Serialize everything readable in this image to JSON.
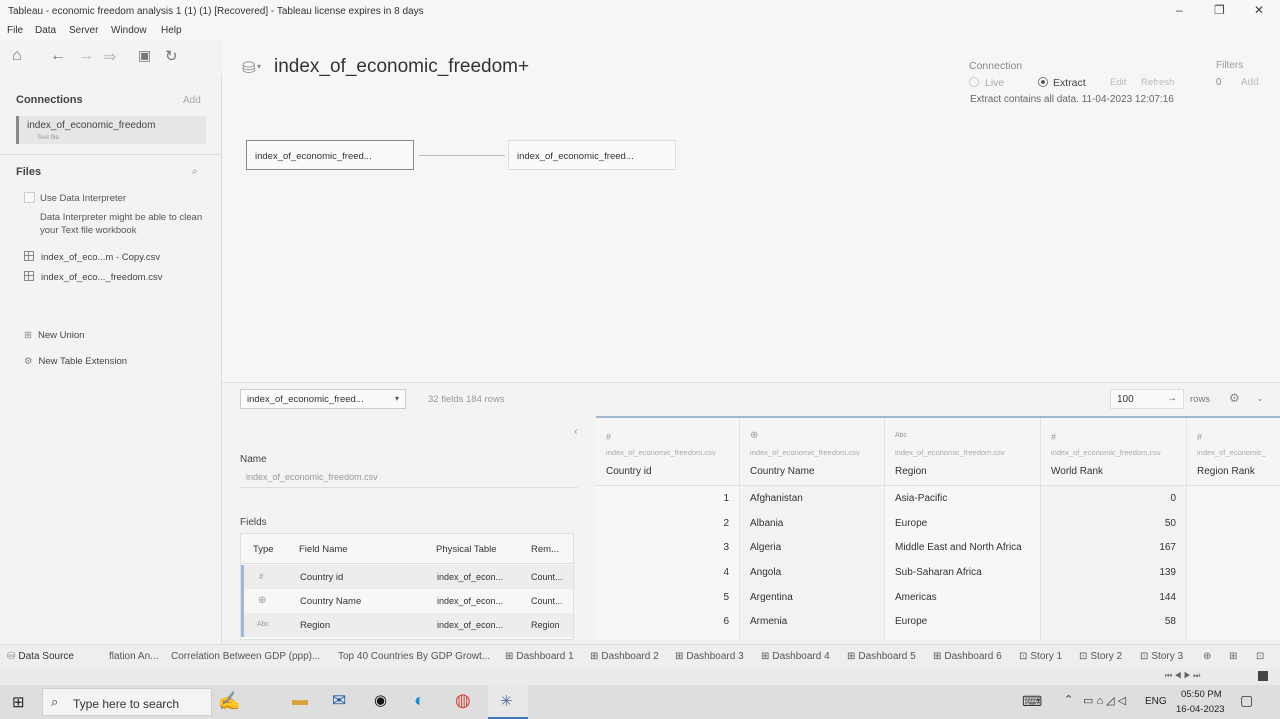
{
  "window": {
    "title": "Tableau - economic freedom analysis 1 (1) (1) [Recovered] - Tableau license expires in 8 days",
    "controls": [
      "–",
      "❐",
      "✕"
    ]
  },
  "menu": [
    "File",
    "Data",
    "Server",
    "Window",
    "Help"
  ],
  "sidebar": {
    "connections_label": "Connections",
    "add_label": "Add",
    "connection": {
      "name": "index_of_economic_freedom",
      "type": "Text file"
    },
    "files_label": "Files",
    "interpreter_label": "Use Data Interpreter",
    "interpreter_note": "Data Interpreter might be able to clean your Text file workbook",
    "files": [
      "index_of_eco...m - Copy.csv",
      "index_of_eco..._freedom.csv"
    ],
    "new_union": "New Union",
    "new_table_extension": "New Table Extension"
  },
  "datasource": {
    "title": "index_of_economic_freedom+",
    "connection_label": "Connection",
    "live_label": "Live",
    "extract_label": "Extract",
    "edit_label": "Edit",
    "refresh_label": "Refresh",
    "extract_note": "Extract contains all data. 11-04-2023 12:07:16",
    "filters_label": "Filters",
    "filters_count": "0",
    "filters_add": "Add",
    "tables": [
      "index_of_economic_freed...",
      "index_of_economic_freed..."
    ]
  },
  "gridbar": {
    "table_select": "index_of_economic_freed...",
    "fields_info": "32 fields 184 rows",
    "rows_value": "100",
    "rows_label": "rows"
  },
  "meta": {
    "name_label": "Name",
    "name_value": "index_of_economic_freedom.csv",
    "fields_label": "Fields",
    "headers": [
      "Type",
      "Field Name",
      "Physical Table",
      "Rem..."
    ],
    "rows": [
      {
        "type": "#",
        "field": "Country id",
        "table": "index_of_econ...",
        "rem": "Count..."
      },
      {
        "type": "⊕",
        "field": "Country Name",
        "table": "index_of_econ...",
        "rem": "Count..."
      },
      {
        "type": "Abc",
        "field": "Region",
        "table": "index_of_econ...",
        "rem": "Region"
      }
    ]
  },
  "grid": {
    "columns": [
      {
        "icon": "#",
        "source": "index_of_economic_freedom.csv",
        "name": "Country id",
        "values": [
          "1",
          "2",
          "3",
          "4",
          "5",
          "6"
        ]
      },
      {
        "icon": "⊕",
        "source": "index_of_economic_freedom.csv",
        "name": "Country Name",
        "values": [
          "Afghanistan",
          "Albania",
          "Algeria",
          "Angola",
          "Argentina",
          "Armenia"
        ]
      },
      {
        "icon": "Abc",
        "source": "index_of_economic_freedom.csv",
        "name": "Region",
        "values": [
          "Asia-Pacific",
          "Europe",
          "Middle East and North Africa",
          "Sub-Saharan Africa",
          "Americas",
          "Europe"
        ]
      },
      {
        "icon": "#",
        "source": "index_of_economic_freedom.csv",
        "name": "World Rank",
        "values": [
          "0",
          "50",
          "167",
          "139",
          "144",
          "58"
        ]
      },
      {
        "icon": "#",
        "source": "index_of_economic_",
        "name": "Region Rank",
        "values": [
          "",
          "",
          "",
          "",
          "",
          ""
        ]
      }
    ]
  },
  "tabs": [
    "Data Source",
    "flation An...",
    "Correlation Between GDP (ppp)...",
    "Top 40 Countries By GDP Growt...",
    "Dashboard 1",
    "Dashboard 2",
    "Dashboard 3",
    "Dashboard 4",
    "Dashboard 5",
    "Dashboard 6",
    "Story 1",
    "Story 2",
    "Story 3"
  ],
  "taskbar": {
    "search_placeholder": "Type here to search",
    "lang": "ENG",
    "time": "05:50 PM",
    "date": "16-04-2023"
  }
}
